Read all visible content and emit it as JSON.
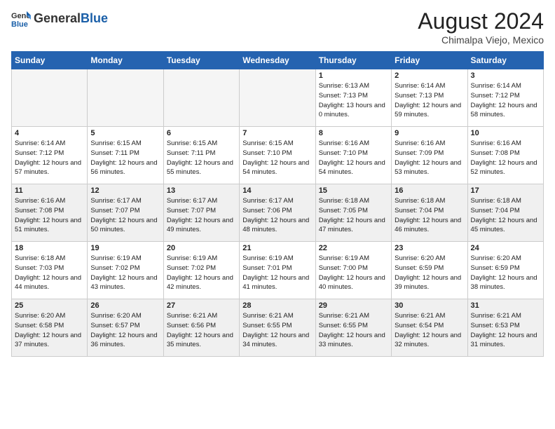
{
  "header": {
    "logo_general": "General",
    "logo_blue": "Blue",
    "month_year": "August 2024",
    "location": "Chimalpa Viejo, Mexico"
  },
  "days_of_week": [
    "Sunday",
    "Monday",
    "Tuesday",
    "Wednesday",
    "Thursday",
    "Friday",
    "Saturday"
  ],
  "weeks": [
    [
      {
        "day": "",
        "empty": true
      },
      {
        "day": "",
        "empty": true
      },
      {
        "day": "",
        "empty": true
      },
      {
        "day": "",
        "empty": true
      },
      {
        "day": "1",
        "sunrise": "6:13 AM",
        "sunset": "7:13 PM",
        "daylight": "13 hours and 0 minutes."
      },
      {
        "day": "2",
        "sunrise": "6:14 AM",
        "sunset": "7:13 PM",
        "daylight": "12 hours and 59 minutes."
      },
      {
        "day": "3",
        "sunrise": "6:14 AM",
        "sunset": "7:12 PM",
        "daylight": "12 hours and 58 minutes."
      }
    ],
    [
      {
        "day": "4",
        "sunrise": "6:14 AM",
        "sunset": "7:12 PM",
        "daylight": "12 hours and 57 minutes."
      },
      {
        "day": "5",
        "sunrise": "6:15 AM",
        "sunset": "7:11 PM",
        "daylight": "12 hours and 56 minutes."
      },
      {
        "day": "6",
        "sunrise": "6:15 AM",
        "sunset": "7:11 PM",
        "daylight": "12 hours and 55 minutes."
      },
      {
        "day": "7",
        "sunrise": "6:15 AM",
        "sunset": "7:10 PM",
        "daylight": "12 hours and 54 minutes."
      },
      {
        "day": "8",
        "sunrise": "6:16 AM",
        "sunset": "7:10 PM",
        "daylight": "12 hours and 54 minutes."
      },
      {
        "day": "9",
        "sunrise": "6:16 AM",
        "sunset": "7:09 PM",
        "daylight": "12 hours and 53 minutes."
      },
      {
        "day": "10",
        "sunrise": "6:16 AM",
        "sunset": "7:08 PM",
        "daylight": "12 hours and 52 minutes."
      }
    ],
    [
      {
        "day": "11",
        "sunrise": "6:16 AM",
        "sunset": "7:08 PM",
        "daylight": "12 hours and 51 minutes."
      },
      {
        "day": "12",
        "sunrise": "6:17 AM",
        "sunset": "7:07 PM",
        "daylight": "12 hours and 50 minutes."
      },
      {
        "day": "13",
        "sunrise": "6:17 AM",
        "sunset": "7:07 PM",
        "daylight": "12 hours and 49 minutes."
      },
      {
        "day": "14",
        "sunrise": "6:17 AM",
        "sunset": "7:06 PM",
        "daylight": "12 hours and 48 minutes."
      },
      {
        "day": "15",
        "sunrise": "6:18 AM",
        "sunset": "7:05 PM",
        "daylight": "12 hours and 47 minutes."
      },
      {
        "day": "16",
        "sunrise": "6:18 AM",
        "sunset": "7:04 PM",
        "daylight": "12 hours and 46 minutes."
      },
      {
        "day": "17",
        "sunrise": "6:18 AM",
        "sunset": "7:04 PM",
        "daylight": "12 hours and 45 minutes."
      }
    ],
    [
      {
        "day": "18",
        "sunrise": "6:18 AM",
        "sunset": "7:03 PM",
        "daylight": "12 hours and 44 minutes."
      },
      {
        "day": "19",
        "sunrise": "6:19 AM",
        "sunset": "7:02 PM",
        "daylight": "12 hours and 43 minutes."
      },
      {
        "day": "20",
        "sunrise": "6:19 AM",
        "sunset": "7:02 PM",
        "daylight": "12 hours and 42 minutes."
      },
      {
        "day": "21",
        "sunrise": "6:19 AM",
        "sunset": "7:01 PM",
        "daylight": "12 hours and 41 minutes."
      },
      {
        "day": "22",
        "sunrise": "6:19 AM",
        "sunset": "7:00 PM",
        "daylight": "12 hours and 40 minutes."
      },
      {
        "day": "23",
        "sunrise": "6:20 AM",
        "sunset": "6:59 PM",
        "daylight": "12 hours and 39 minutes."
      },
      {
        "day": "24",
        "sunrise": "6:20 AM",
        "sunset": "6:59 PM",
        "daylight": "12 hours and 38 minutes."
      }
    ],
    [
      {
        "day": "25",
        "sunrise": "6:20 AM",
        "sunset": "6:58 PM",
        "daylight": "12 hours and 37 minutes."
      },
      {
        "day": "26",
        "sunrise": "6:20 AM",
        "sunset": "6:57 PM",
        "daylight": "12 hours and 36 minutes."
      },
      {
        "day": "27",
        "sunrise": "6:21 AM",
        "sunset": "6:56 PM",
        "daylight": "12 hours and 35 minutes."
      },
      {
        "day": "28",
        "sunrise": "6:21 AM",
        "sunset": "6:55 PM",
        "daylight": "12 hours and 34 minutes."
      },
      {
        "day": "29",
        "sunrise": "6:21 AM",
        "sunset": "6:55 PM",
        "daylight": "12 hours and 33 minutes."
      },
      {
        "day": "30",
        "sunrise": "6:21 AM",
        "sunset": "6:54 PM",
        "daylight": "12 hours and 32 minutes."
      },
      {
        "day": "31",
        "sunrise": "6:21 AM",
        "sunset": "6:53 PM",
        "daylight": "12 hours and 31 minutes."
      }
    ]
  ]
}
